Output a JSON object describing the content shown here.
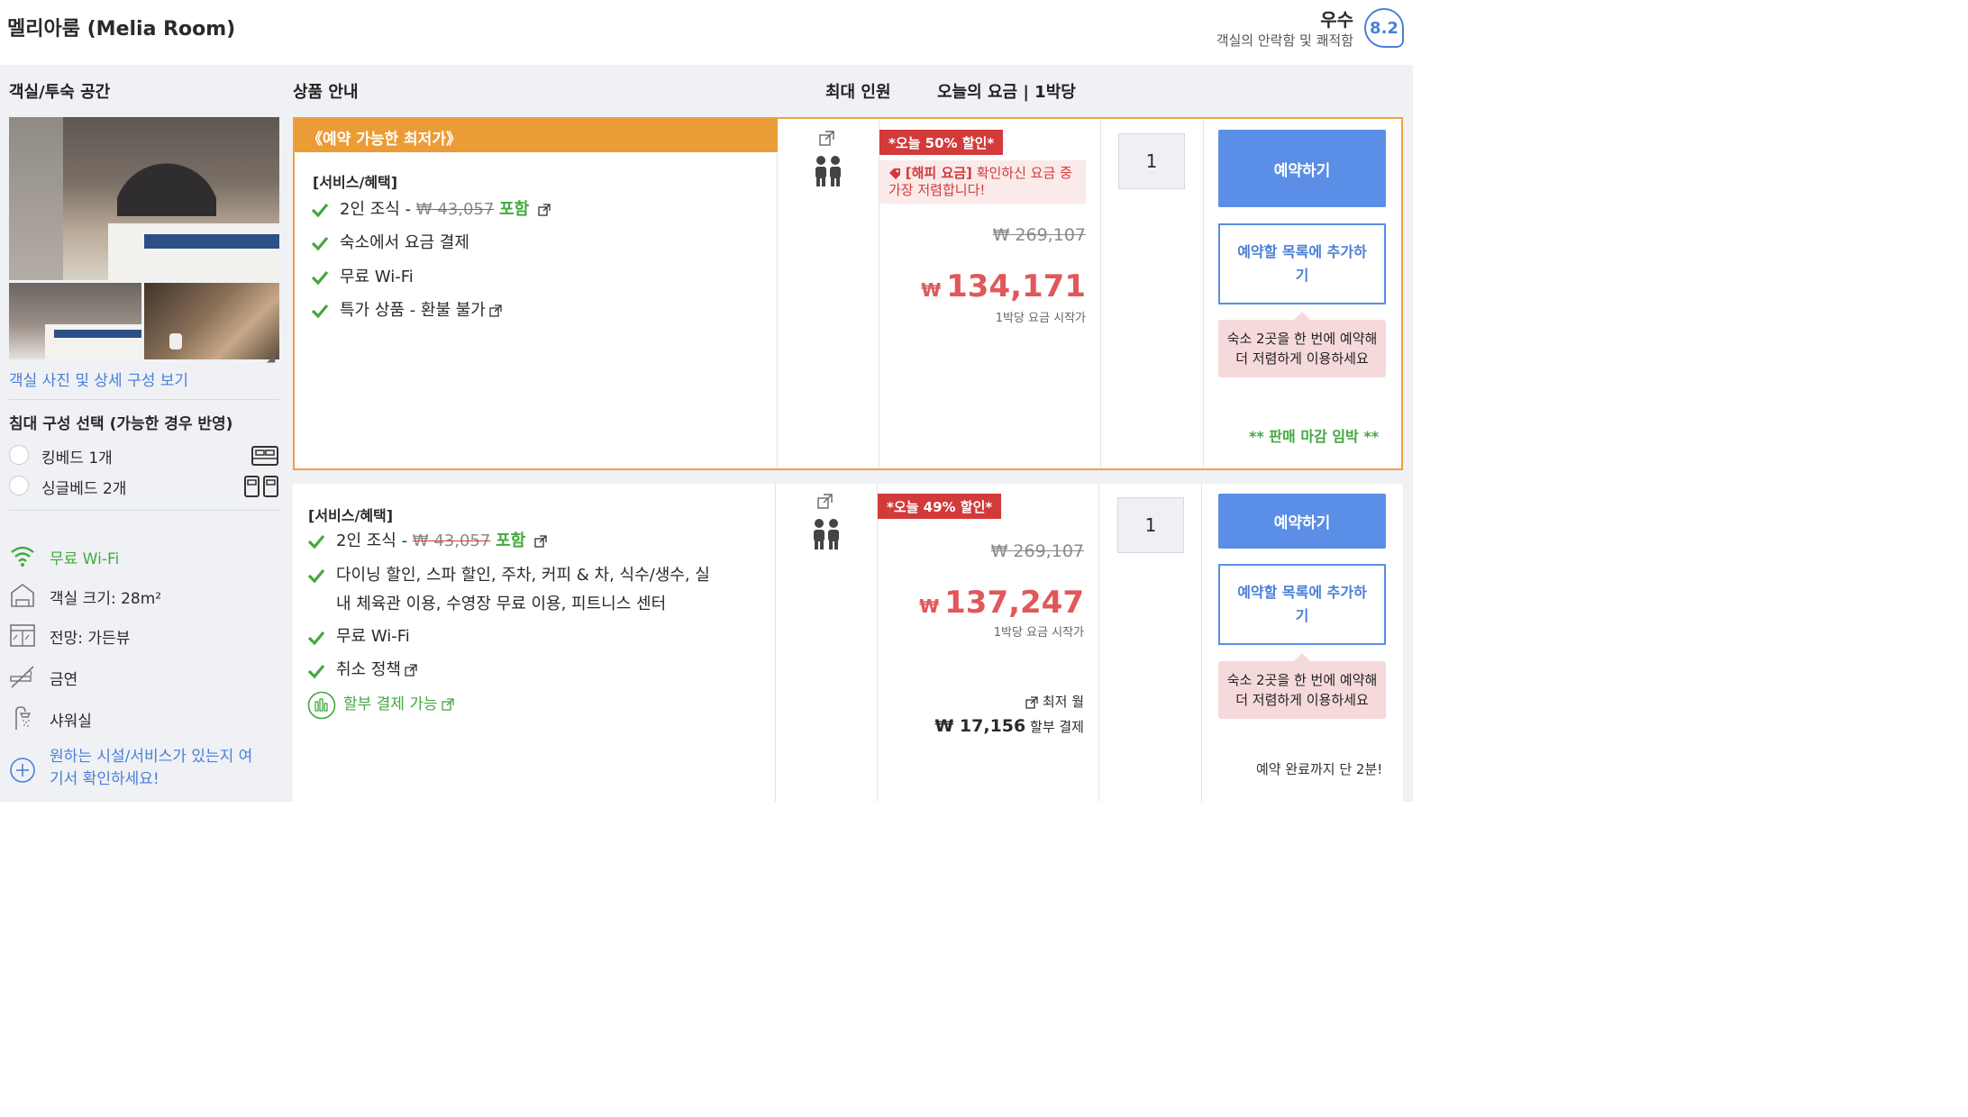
{
  "header": {
    "room_title": "멜리아룸 (Melia Room)",
    "score_word": "우수",
    "score_sub": "객실의 안락함 및 쾌적함",
    "score": "8.2"
  },
  "columns": {
    "room": "객실/투숙 공간",
    "product": "상품 안내",
    "max_guests": "최대 인원",
    "price": "오늘의 요금 | 1박당"
  },
  "left": {
    "photos_link": "객실 사진 및 상세 구성 보기",
    "bed_title": "침대 구성 선택 (가능한 경우 반영)",
    "beds": [
      "킹베드 1개",
      "싱글베드 2개"
    ],
    "amenities": [
      "무료 Wi-Fi",
      "객실 크기: 28m²",
      "전망: 가든뷰",
      "금연",
      "샤워실"
    ],
    "request_link": [
      "원하는 시설/서비스가 있는지 여",
      "기서 확인하세요!"
    ]
  },
  "offer1": {
    "banner": "《예약 가능한 최저가》",
    "svc_title": "[서비스/혜택]",
    "breakfast_prefix": "2인 조식 - ",
    "breakfast_strike": "₩ 43,057",
    "breakfast_incl": "포함",
    "services": [
      "숙소에서 요금 결제",
      "무료 Wi-Fi",
      "특가 상품 - 환불 불가"
    ],
    "discount": "*오늘 50% 할인*",
    "happy_bold": "[해피 요금]",
    "happy_text": " 확인하신 요금 중 가장 저렴합니다!",
    "original": "₩ 269,107",
    "currency": "₩",
    "price": "134,171",
    "per_night": "1박당 요금 시작가",
    "qty": "1",
    "book": "예약하기",
    "add_list": "예약할 목록에 추가하기",
    "tip": "숙소 2곳을 한 번에 예약해 더 저렴하게 이용하세요",
    "closing": "** 판매 마감 임박 **"
  },
  "offer2": {
    "svc_title": "[서비스/혜택]",
    "breakfast_prefix": "2인 조식 - ",
    "breakfast_strike": "₩ 43,057",
    "breakfast_incl": "포함",
    "dining": [
      "다이닝 할인, 스파 할인, 주차, 커피 & 차, 식수/생수, 실",
      "내 체육관 이용, 수영장 무료 이용, 피트니스 센터"
    ],
    "services": [
      "무료 Wi-Fi",
      "취소 정책"
    ],
    "installment": "할부 결제 가능",
    "discount": "*오늘 49% 할인*",
    "original": "₩ 269,107",
    "currency": "₩",
    "price": "137,247",
    "per_night": "1박당 요금 시작가",
    "monthly_label": "최저 월",
    "monthly_amount": "₩ 17,156",
    "monthly_suffix": " 할부 결제",
    "qty": "1",
    "book": "예약하기",
    "add_list": "예약할 목록에 추가하기",
    "tip": "숙소 2곳을 한 번에 예약해 더 저렴하게 이용하세요",
    "lastmin": "예약 완료까지 단 2분!"
  },
  "colors": {
    "accent_blue": "#5b8ee6",
    "price_red": "#e0585a",
    "banner_orange": "#ec9c36",
    "check_green": "#44a840",
    "badge_red": "#d33a3a"
  },
  "icons": [
    "external-link-icon",
    "guests-icon",
    "check-icon",
    "tag-icon",
    "wifi-icon",
    "room-size-icon",
    "view-icon",
    "no-smoking-icon",
    "shower-icon",
    "plus-circle-icon",
    "king-bed-icon",
    "twin-bed-icon",
    "installment-icon"
  ]
}
